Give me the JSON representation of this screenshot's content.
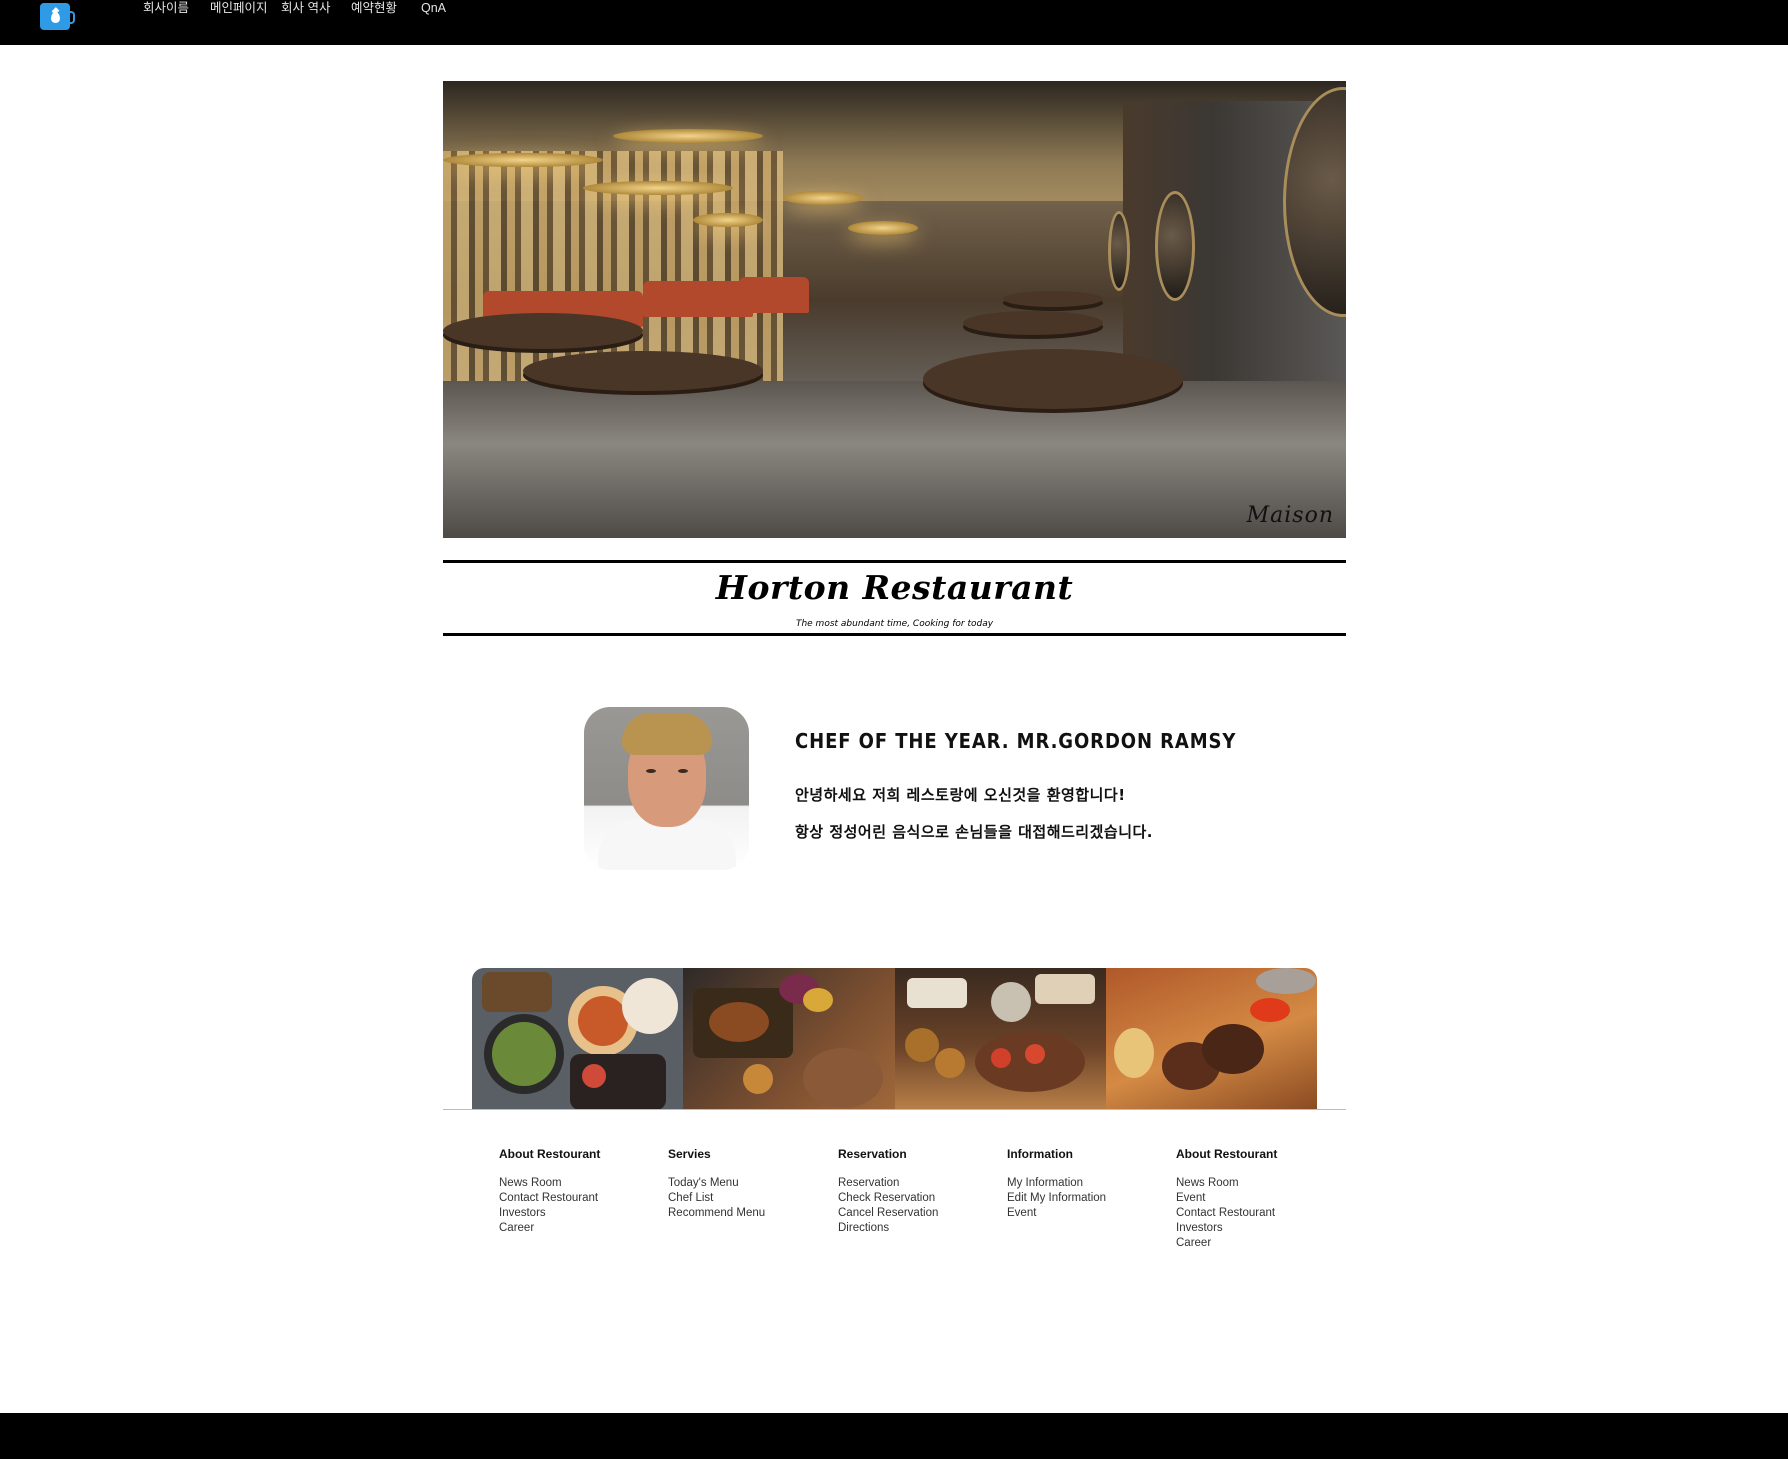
{
  "nav": {
    "logo_icon": "coffee-cup-drop-icon",
    "items": [
      "회사이름",
      "메인페이지",
      "회사 역사",
      "예약현황",
      "QnA"
    ]
  },
  "hero": {
    "image": "restaurant-interior-photo",
    "watermark": "Maison"
  },
  "title": {
    "main": "Horton Restaurant",
    "sub": "The most abundant time, Cooking for today"
  },
  "chef": {
    "photo": "chef-portrait-photo",
    "heading": "CHEF OF THE YEAR. MR.GORDON RAMSY",
    "lines": [
      "안녕하세요 저희 레스토랑에 오신것을 환영합니다!",
      "항상 정성어린 음식으로 손님들을 대접해드리겠습니다."
    ]
  },
  "food_strip": [
    "food-platter-photo",
    "food-board-photo",
    "food-appetizers-photo",
    "steak-photo"
  ],
  "footer": {
    "columns": [
      {
        "title": "About Restourant",
        "links": [
          "News Room",
          "Contact Restourant",
          "Investors",
          "Career"
        ]
      },
      {
        "title": "Servies",
        "links": [
          "Today's Menu",
          "Chef List",
          "Recommend Menu"
        ]
      },
      {
        "title": "Reservation",
        "links": [
          "Reservation",
          "Check Reservation",
          "Cancel Reservation",
          "Directions"
        ]
      },
      {
        "title": "Information",
        "links": [
          "My Information",
          "Edit My Information",
          "Event"
        ]
      },
      {
        "title": "About Restourant",
        "links": [
          "News Room",
          "Event",
          "Contact Restourant",
          "Investors",
          "Career"
        ]
      }
    ]
  },
  "colors": {
    "nav_bg": "#000000",
    "logo": "#2f9be6",
    "page_bg": "#ffffff"
  }
}
